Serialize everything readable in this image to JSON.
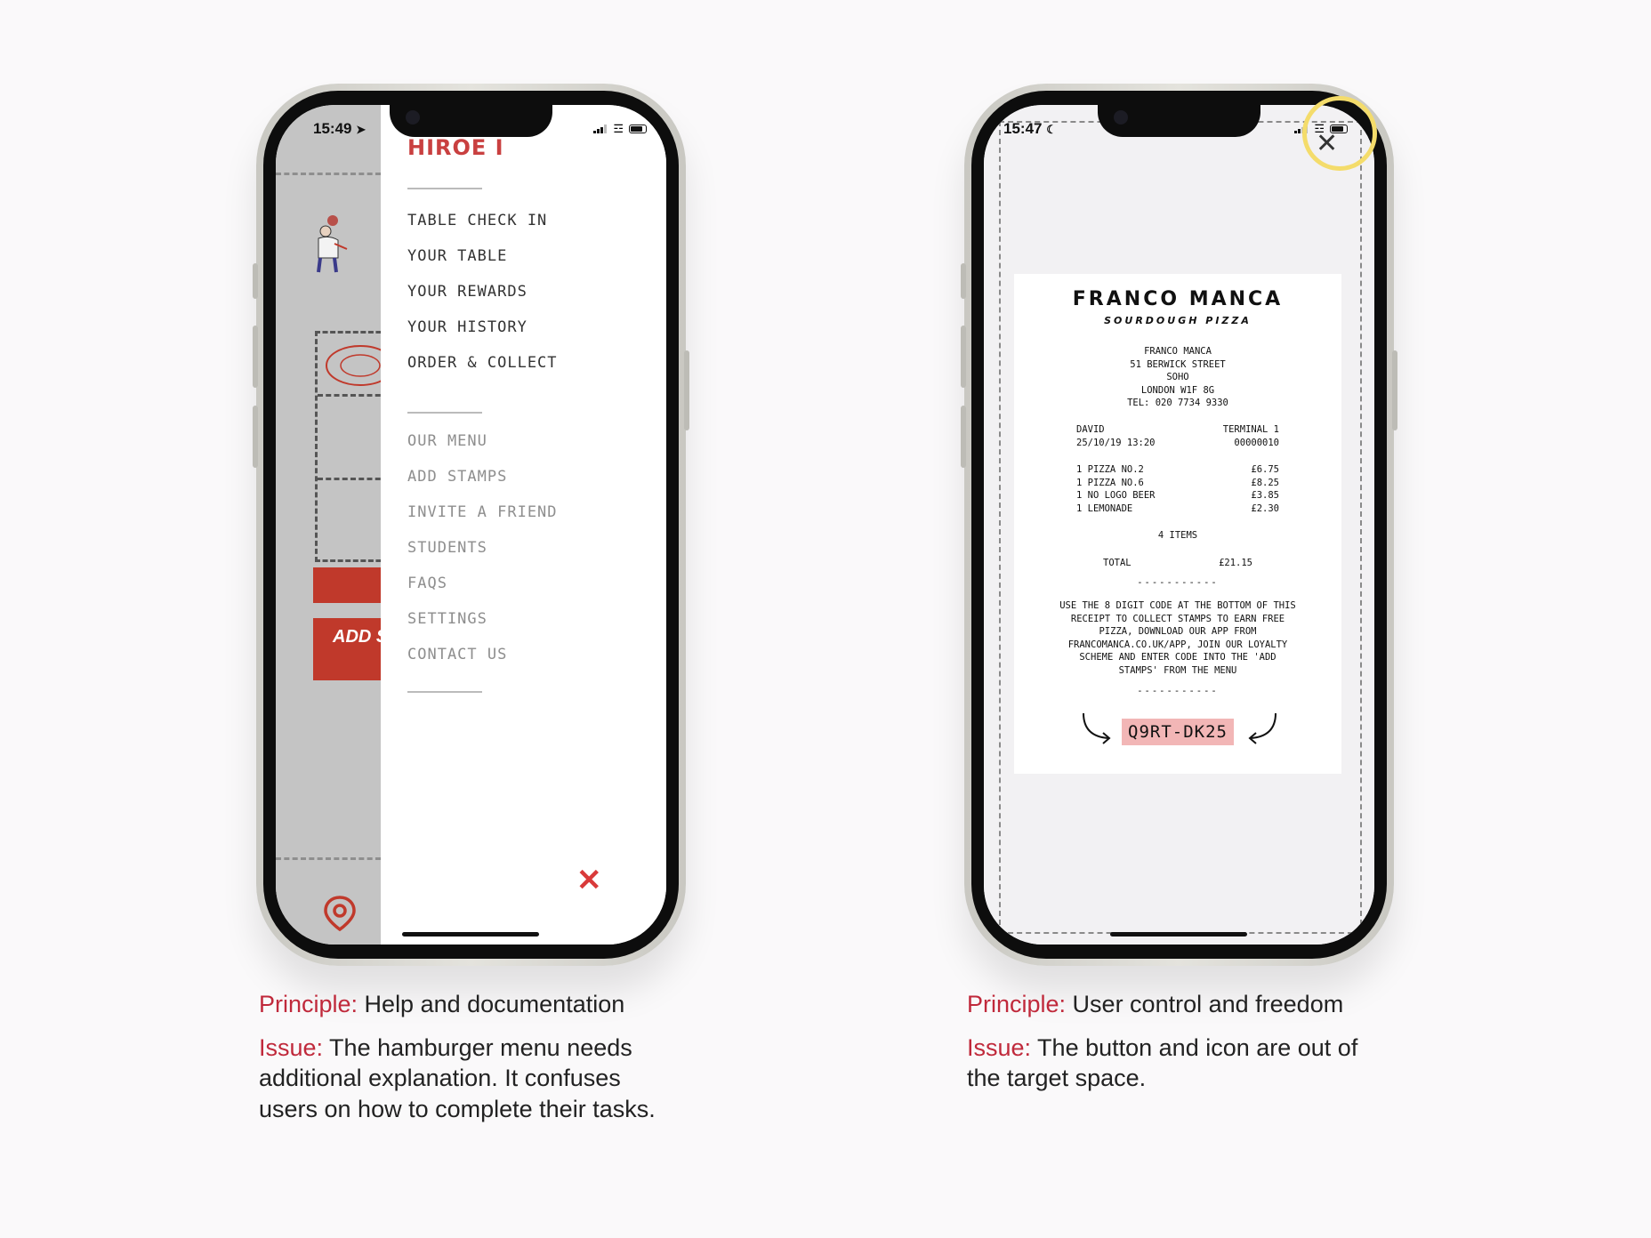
{
  "left_phone": {
    "status": {
      "time": "15:49"
    },
    "brand": "HIROE I",
    "add_button_partial": "ADD S",
    "menu_primary": [
      "TABLE CHECK IN",
      "YOUR TABLE",
      "YOUR REWARDS",
      "YOUR HISTORY",
      "ORDER & COLLECT"
    ],
    "menu_secondary": [
      "OUR MENU",
      "ADD STAMPS",
      "INVITE A FRIEND",
      "STUDENTS",
      "FAQS",
      "SETTINGS",
      "CONTACT US"
    ],
    "close_icon": "✕",
    "icons": [
      "location-pin-icon",
      "close-icon",
      "cellular-signal-icon",
      "wifi-icon",
      "battery-icon",
      "location-arrow-icon"
    ]
  },
  "right_phone": {
    "status": {
      "time": "15:47"
    },
    "close_icon": "✕",
    "receipt": {
      "brand": "FRANCO MANCA",
      "subtitle": "SOURDOUGH PIZZA",
      "address_lines": [
        "FRANCO MANCA",
        "51 BERWICK STREET",
        "SOHO",
        "LONDON W1F 8G",
        "TEL: 020 7734 9330"
      ],
      "server": "DAVID",
      "terminal": "TERMINAL 1",
      "datetime": "25/10/19 13:20",
      "txn": "00000010",
      "items": [
        {
          "name": "1 PIZZA NO.2",
          "price": "£6.75"
        },
        {
          "name": "1 PIZZA NO.6",
          "price": "£8.25"
        },
        {
          "name": "1 NO LOGO BEER",
          "price": "£3.85"
        },
        {
          "name": "1 LEMONADE",
          "price": "£2.30"
        }
      ],
      "item_count": "4 ITEMS",
      "total_label": "TOTAL",
      "total_value": "£21.15",
      "separator": "-----------",
      "instructions": [
        "USE THE 8 DIGIT CODE AT THE BOTTOM OF THIS",
        "RECEIPT TO COLLECT STAMPS TO EARN FREE",
        "PIZZA, DOWNLOAD OUR APP FROM",
        "FRANCOMANCA.CO.UK/APP, JOIN OUR LOYALTY",
        "SCHEME AND ENTER CODE INTO THE 'ADD",
        "STAMPS' FROM THE MENU"
      ],
      "code": "Q9RT-DK25"
    },
    "highlight_color": "#f4dc6b"
  },
  "captions": {
    "left": {
      "principle_label": "Principle:",
      "principle_text": " Help and documentation",
      "issue_label": "Issue:",
      "issue_text": " The hamburger menu needs additional explanation. It confuses users on how to complete their tasks."
    },
    "right": {
      "principle_label": "Principle:",
      "principle_text": " User control and freedom",
      "issue_label": "Issue:",
      "issue_text": " The button and icon are out of the target space."
    }
  },
  "colors": {
    "accent_red": "#c0293b",
    "menu_red": "#d93a3a",
    "code_highlight": "#f2b6b6",
    "page_bg": "#faf9fa"
  }
}
